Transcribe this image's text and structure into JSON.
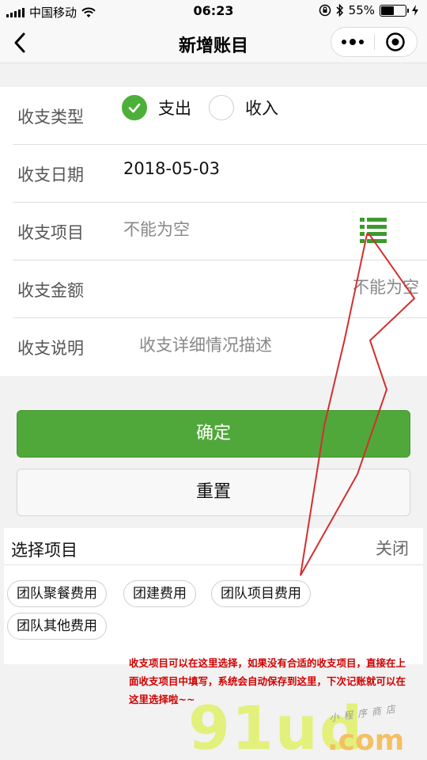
{
  "status_bar": {
    "carrier": "中国移动",
    "time": "06:23",
    "battery_text": "55%",
    "battery_level": 0.55
  },
  "nav": {
    "title": "新增账目"
  },
  "form": {
    "type_label": "收支类型",
    "type_options": [
      {
        "label": "支出",
        "checked": true
      },
      {
        "label": "收入",
        "checked": false
      }
    ],
    "date_label": "收支日期",
    "date_value": "2018-05-03",
    "item_label": "收支项目",
    "item_placeholder": "不能为空",
    "amount_label": "收支金额",
    "amount_placeholder": "不能为空",
    "desc_label": "收支说明",
    "desc_placeholder": "收支详细情况描述"
  },
  "buttons": {
    "confirm": "确定",
    "reset": "重置"
  },
  "picker": {
    "title": "选择项目",
    "close": "关闭",
    "chips": [
      "团队聚餐费用",
      "团建费用",
      "团队项目费用",
      "团队其他费用"
    ]
  },
  "annotation": {
    "note": "收支项目可以在这里选择，如果没有合适的收支项目，直接在上面收支项目中填写，系统会自动保存到这里，下次记账就可以在这里选择啦~~",
    "color": "#d00000"
  },
  "watermark": {
    "logo": "91ud",
    "domain": ".com",
    "tagline": "小程序商店"
  },
  "colors": {
    "accent": "#50a83a"
  }
}
